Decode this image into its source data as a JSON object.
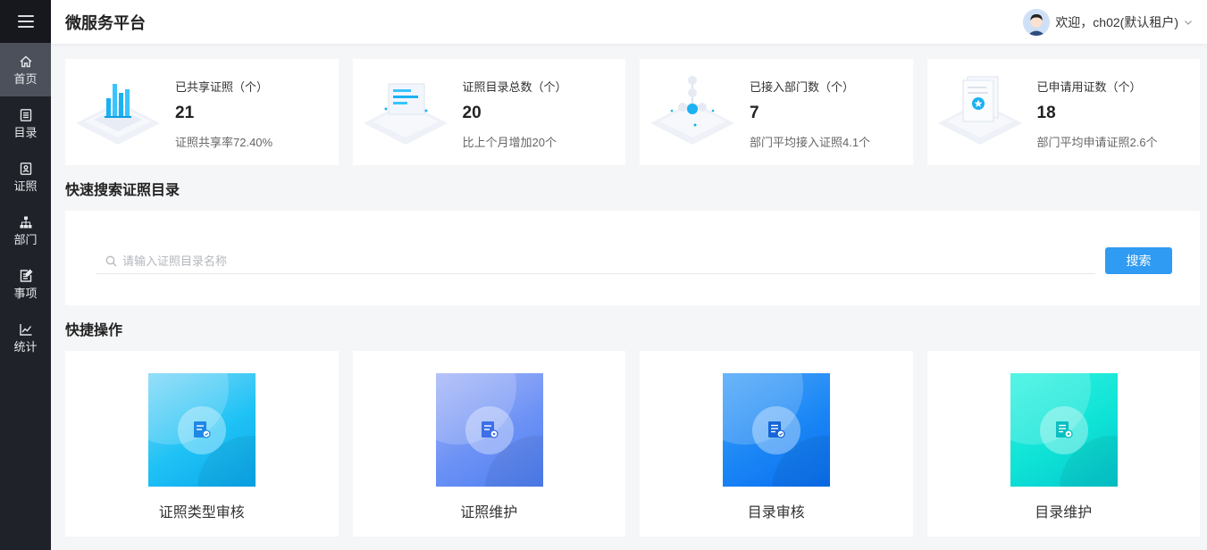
{
  "app": {
    "title": "微服务平台"
  },
  "user": {
    "welcome": "欢迎，ch02(默认租户)"
  },
  "sidebar": {
    "items": [
      {
        "label": "首页",
        "icon": "home-icon",
        "active": true
      },
      {
        "label": "目录",
        "icon": "list-icon"
      },
      {
        "label": "证照",
        "icon": "id-card-icon"
      },
      {
        "label": "部门",
        "icon": "org-chart-icon"
      },
      {
        "label": "事项",
        "icon": "edit-doc-icon"
      },
      {
        "label": "统计",
        "icon": "line-chart-icon"
      }
    ]
  },
  "stats": [
    {
      "label": "已共享证照（个）",
      "value": "21",
      "sub": "证照共享率72.40%",
      "icon": "bar-chart-illustration"
    },
    {
      "label": "证照目录总数（个）",
      "value": "20",
      "sub": "比上个月增加20个",
      "icon": "monitor-illustration"
    },
    {
      "label": "已接入部门数（个）",
      "value": "7",
      "sub": "部门平均接入证照4.1个",
      "icon": "network-illustration"
    },
    {
      "label": "已申请用证数（个）",
      "value": "18",
      "sub": "部门平均申请证照2.6个",
      "icon": "document-badge-illustration"
    }
  ],
  "search": {
    "title": "快速搜索证照目录",
    "placeholder": "请输入证照目录名称",
    "value": "",
    "button": "搜索"
  },
  "quick": {
    "title": "快捷操作",
    "items": [
      {
        "label": "证照类型审核",
        "icon": "certificate-review-icon",
        "colors": [
          "#7fd8f7",
          "#1fc2f5",
          "#0aa8ee"
        ]
      },
      {
        "label": "证照维护",
        "icon": "certificate-maintain-icon",
        "colors": [
          "#a7b6f7",
          "#6d92f5",
          "#4d7ef2"
        ]
      },
      {
        "label": "目录审核",
        "icon": "catalog-review-icon",
        "colors": [
          "#4aa5f8",
          "#1a86f5",
          "#0a6ef0"
        ]
      },
      {
        "label": "目录维护",
        "icon": "catalog-maintain-icon",
        "colors": [
          "#31f2e0",
          "#0fe3d6",
          "#05c7cf"
        ]
      }
    ]
  },
  "theme": {
    "sidebar": "#1f2329",
    "sidebar_active": "#4b505a",
    "primary": "#2f9bf2",
    "accent": "#1bb1f3"
  }
}
